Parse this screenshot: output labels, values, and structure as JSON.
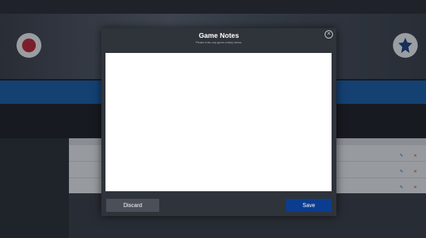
{
  "modal": {
    "title": "Game Notes",
    "subtitle": "Please enter any game note(s) below.",
    "notes_value": "",
    "discard_label": "Discard",
    "save_label": "Save",
    "close_icon": "close-icon"
  },
  "colors": {
    "modal_bg": "#2f333a",
    "save_button": "#0a3d8f",
    "discard_button": "#4b4f57",
    "header_blue": "#1b5ea6"
  }
}
